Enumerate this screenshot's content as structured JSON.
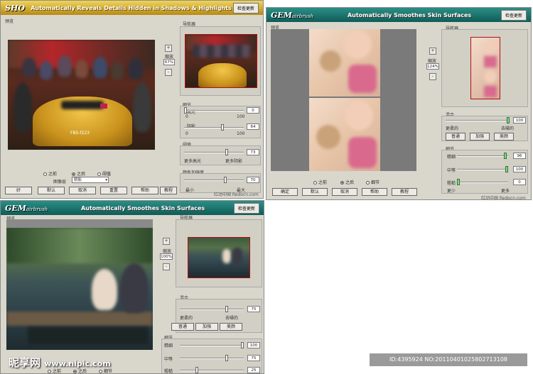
{
  "win1": {
    "logo": "SHO",
    "title": "Automatically Reveals Details Hidden in Shadows & Highlights",
    "update_btn": "检查更新",
    "preview_label": "预览",
    "photo_text": "FBS-f223",
    "zoom_label": "缩放",
    "zoom_value": "67%",
    "plus": "+",
    "minus": "-",
    "navigator_label": "导航器",
    "details_label": "细节",
    "highlight_label": "高光",
    "highlight_value": "0",
    "highlight_min": "0",
    "highlight_max": "100",
    "shadow_label": "阴影",
    "shadow_value": "64",
    "shadow_min": "0",
    "shadow_max": "100",
    "threshold_label": "阈值",
    "threshold_value": "73",
    "threshold_left": "更多高光",
    "threshold_right": "更多阴影",
    "color_label": "颜色加强度",
    "color_value": "70",
    "color_left": "最小",
    "color_right": "最大",
    "radio_before": "之前",
    "radio_after": "之后",
    "radio_threshold": "阈值",
    "view_label": "图像层",
    "view_select": "阴影",
    "btn_ok": "好",
    "btn_default": "默认",
    "btn_cancel": "取消",
    "btn_reset": "重置",
    "btn_help": "帮助",
    "btn_tutorial": "教程",
    "watermark": "红动中国 Redocn.com"
  },
  "win2": {
    "logo": "GEM",
    "logo_sub": "airbrush",
    "title": "Automatically Smoothes Skin Surfaces",
    "update_btn": "检查更新",
    "preview_label": "预览",
    "zoom_label": "缩放",
    "zoom_value": "124%",
    "plus": "+",
    "minus": "-",
    "navigator_label": "导航器",
    "blend_label": "混合",
    "blend_value": "100",
    "blend_left": "更柔的",
    "blend_right": "去噪的",
    "mode_normal": "普通",
    "mode_strong": "加强",
    "mode_smooth": "美颜",
    "detail_label": "细节",
    "fine_label": "精细",
    "fine_value": "96",
    "medium_label": "中等",
    "medium_value": "100",
    "coarse_label": "粗糙",
    "coarse_value": "0",
    "less_label": "更少",
    "more_label": "更多",
    "radio_before": "之前",
    "radio_after": "之后",
    "radio_detail": "细节",
    "btn_ok": "确定",
    "btn_default": "默认",
    "btn_cancel": "取消",
    "btn_help": "帮助",
    "btn_tutorial": "教程",
    "watermark": "红动中国 Redocn.com"
  },
  "win3": {
    "logo": "GEM",
    "logo_sub": "airbrush",
    "title": "Automatically Smoothes Skin Surfaces",
    "update_btn": "检查更新",
    "preview_label": "预览",
    "zoom_label": "缩放",
    "zoom_value": "100%",
    "plus": "+",
    "minus": "-",
    "navigator_label": "导航器",
    "blend_label": "混合",
    "blend_value": "75",
    "blend_left": "更柔的",
    "blend_right": "去噪的",
    "mode_normal": "普通",
    "mode_strong": "加强",
    "mode_smooth": "美颜",
    "detail_label": "细节",
    "fine_label": "精细",
    "fine_value": "100",
    "medium_label": "中等",
    "medium_value": "75",
    "coarse_label": "粗糙",
    "coarse_value": "25",
    "radio_before": "之前",
    "radio_after": "之后",
    "radio_detail": "细节"
  },
  "footer": {
    "site_logo": "昵享网",
    "site_url": "www.nipic.com",
    "image_id": "ID:4395924 NO:20110401025802713108"
  }
}
